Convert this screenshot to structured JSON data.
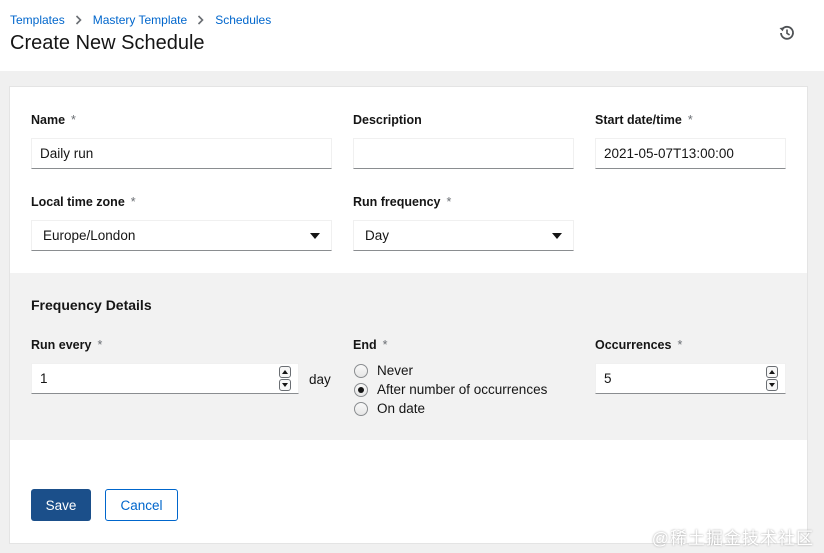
{
  "breadcrumb": {
    "items": [
      "Templates",
      "Mastery Template",
      "Schedules"
    ]
  },
  "page": {
    "title": "Create New Schedule"
  },
  "form": {
    "name": {
      "label": "Name",
      "required_mark": "*",
      "value": "Daily run"
    },
    "description": {
      "label": "Description",
      "value": ""
    },
    "start": {
      "label": "Start date/time",
      "required_mark": "*",
      "value": "2021-05-07T13:00:00"
    },
    "timezone": {
      "label": "Local time zone",
      "required_mark": "*",
      "value": "Europe/London"
    },
    "frequency": {
      "label": "Run frequency",
      "required_mark": "*",
      "value": "Day"
    }
  },
  "frequency_details": {
    "title": "Frequency Details",
    "run_every": {
      "label": "Run every",
      "required_mark": "*",
      "value": "1",
      "unit": "day"
    },
    "end": {
      "label": "End",
      "required_mark": "*",
      "options": [
        "Never",
        "After number of occurrences",
        "On date"
      ],
      "selected": "After number of occurrences"
    },
    "occurrences": {
      "label": "Occurrences",
      "required_mark": "*",
      "value": "5"
    }
  },
  "actions": {
    "save": "Save",
    "cancel": "Cancel"
  },
  "watermark": "@稀土掘金技术社区",
  "colors": {
    "link": "#0066cc",
    "primary_button": "#1b4f8a",
    "section_background": "#f2f2f2"
  },
  "icons": {
    "history": "history-icon",
    "breadcrumb_separator": "chevron-right-icon"
  }
}
